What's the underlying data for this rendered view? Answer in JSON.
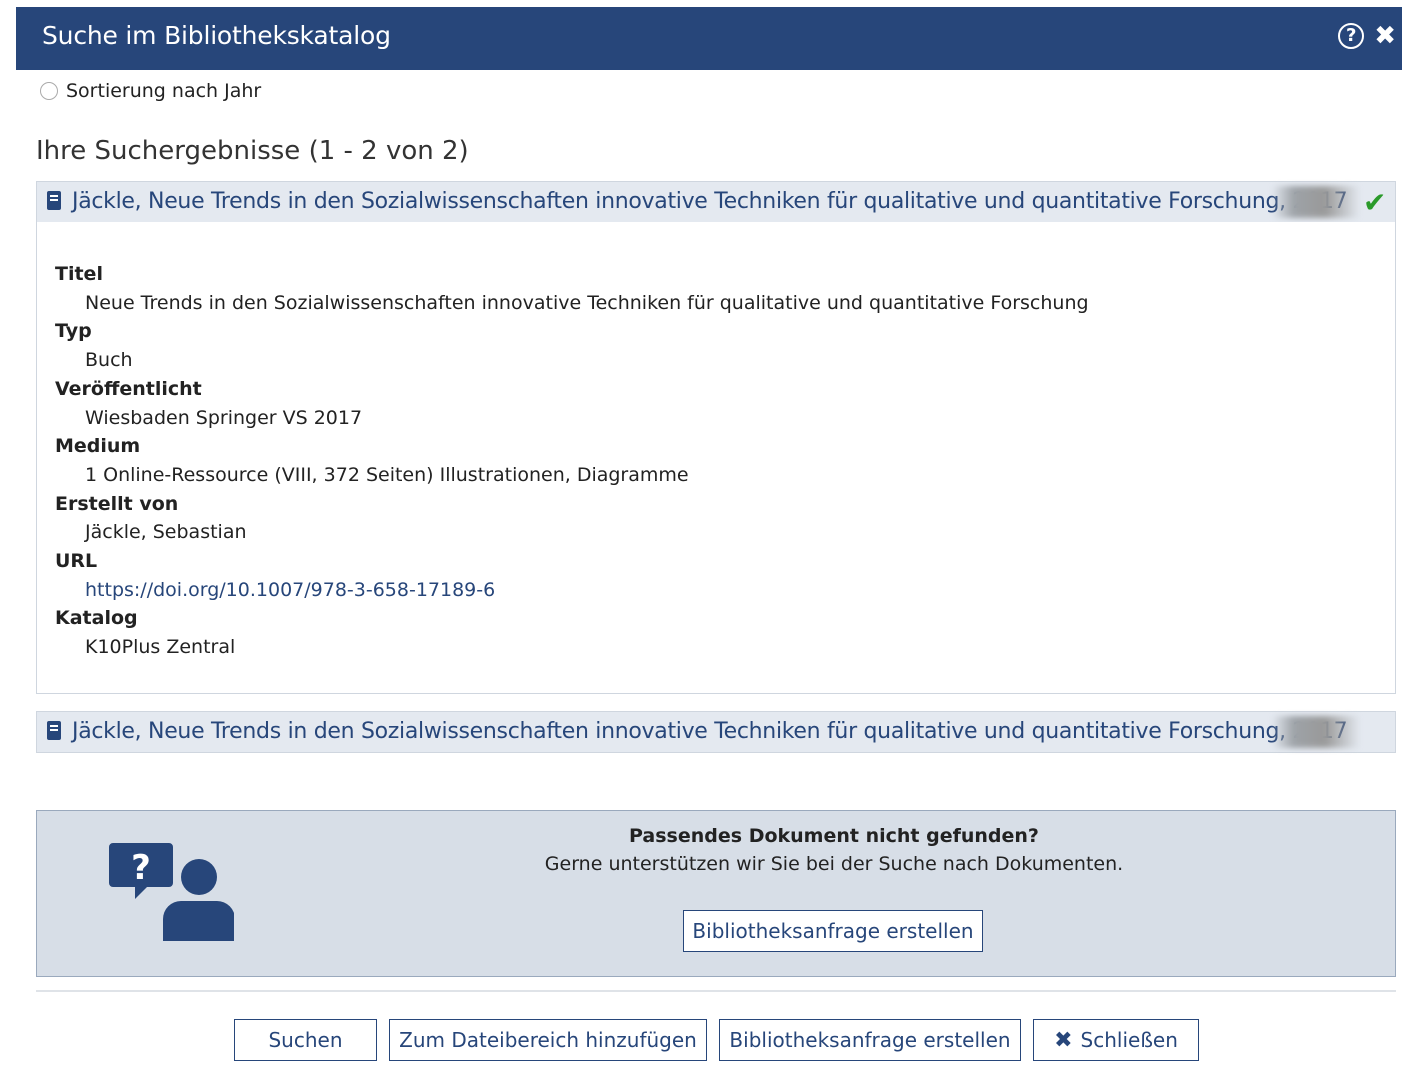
{
  "dialog": {
    "title": "Suche im Bibliothekskatalog",
    "help_icon": "?",
    "close_icon": "✖"
  },
  "sort": {
    "label": "Sortierung nach Jahr",
    "selected": false
  },
  "results": {
    "heading": "Ihre Suchergebnisse (1 - 2 von 2)",
    "items": [
      {
        "title": "Jäckle, Neue Trends in den Sozialwissenschaften innovative Techniken für qualitative und quantitative Forschung, 2017",
        "selected": true,
        "check_icon": "✔"
      },
      {
        "title": "Jäckle, Neue Trends in den Sozialwissenschaften innovative Techniken für qualitative und quantitative Forschung, 2017",
        "selected": false
      }
    ],
    "details": {
      "titel_label": "Titel",
      "titel_value": "Neue Trends in den Sozialwissenschaften innovative Techniken für qualitative und quantitative Forschung",
      "typ_label": "Typ",
      "typ_value": "Buch",
      "published_label": "Veröffentlicht",
      "published_value": "Wiesbaden Springer VS 2017",
      "medium_label": "Medium",
      "medium_value": "1 Online-Ressource (VIII, 372 Seiten) Illustrationen, Diagramme",
      "author_label": "Erstellt von",
      "author_value": "Jäckle, Sebastian",
      "url_label": "URL",
      "url_value": "https://doi.org/10.1007/978-3-658-17189-6",
      "catalog_label": "Katalog",
      "catalog_value": "K10Plus Zentral"
    }
  },
  "help_box": {
    "question": "Passendes Dokument nicht gefunden?",
    "subtext": "Gerne unterstützen wir Sie bei der Suche nach Dokumenten.",
    "button_label": "Bibliotheksanfrage erstellen",
    "icon_glyph": "?"
  },
  "footer": {
    "search_label": "Suchen",
    "add_label": "Zum Dateibereich hinzufügen",
    "request_label": "Bibliotheksanfrage erstellen",
    "close_glyph": "✖",
    "close_label": "Schließen"
  },
  "colors": {
    "primary": "#27467a",
    "header_bg": "#e4e9f0",
    "help_box_bg": "#d7dee7",
    "check": "#2a9a2a"
  }
}
